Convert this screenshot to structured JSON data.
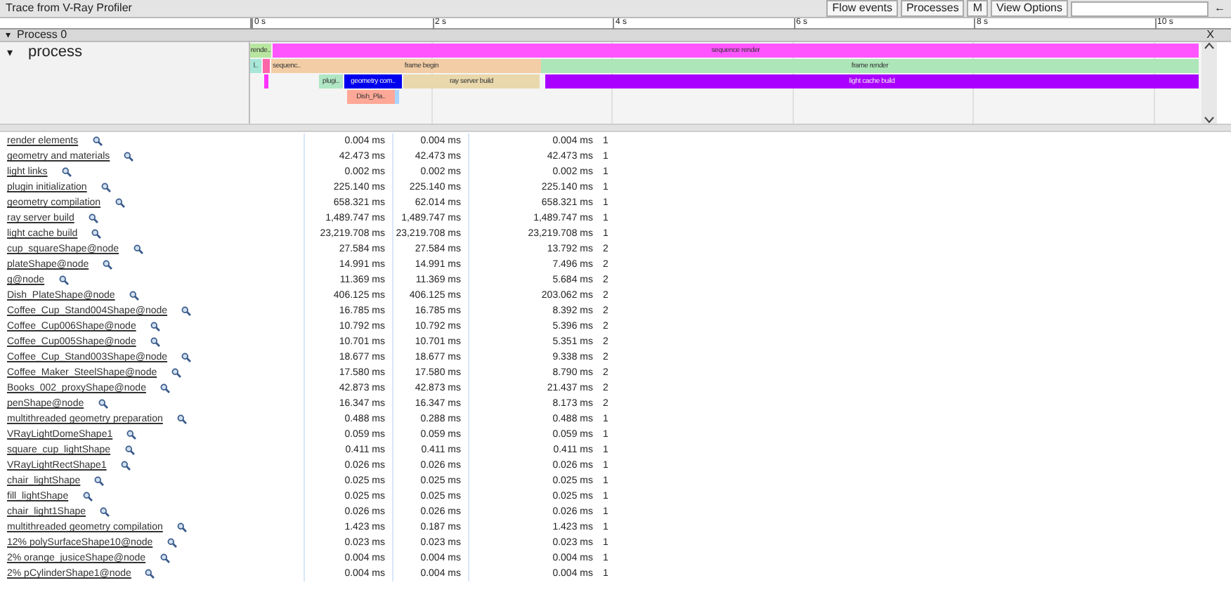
{
  "window": {
    "title": "Trace from V-Ray Profiler"
  },
  "toolbar": {
    "buttons": [
      "Flow events",
      "Processes",
      "M",
      "View Options"
    ],
    "back": "←"
  },
  "ruler": {
    "ticks": [
      "0 s",
      "2 s",
      "4 s",
      "6 s",
      "8 s",
      "10 s"
    ]
  },
  "process_header": {
    "toggle": "▾",
    "label": "Process 0",
    "close": "X"
  },
  "thread": {
    "toggle": "▾",
    "label": "process"
  },
  "tracks": [
    [
      {
        "label": "rende..",
        "color": "#b8e6a0"
      },
      {
        "label": "sequence render",
        "color": "#ff55ff"
      }
    ],
    [
      {
        "label": "l..",
        "color": "#a8e6d8"
      },
      {
        "color": "#ff66aa"
      },
      {
        "label": "sequenc..",
        "color": "#f2cda6"
      },
      {
        "label": "frame begin",
        "color": "#f2cda6"
      },
      {
        "label": "frame render",
        "color": "#ade6b8"
      }
    ],
    [
      {
        "color": "#ff33ff"
      },
      {
        "label": "plugi..",
        "color": "#b0e6c4"
      },
      {
        "label": "geometry com..",
        "color": "#0000ee"
      },
      {
        "label": "ray server build",
        "color": "#e8d8ac"
      },
      {
        "label": "light cache build",
        "color": "#aa00ff"
      }
    ],
    [
      {
        "label": "Dish_Pla..",
        "color": "#ffa898"
      },
      {
        "color": "#a8d4ff"
      }
    ]
  ],
  "rows": [
    {
      "name": "render elements",
      "total": "0.004 ms",
      "self": "0.004 ms",
      "avg": "0.004 ms",
      "count": "1"
    },
    {
      "name": "geometry and materials",
      "total": "42.473 ms",
      "self": "42.473 ms",
      "avg": "42.473 ms",
      "count": "1"
    },
    {
      "name": "light links",
      "total": "0.002 ms",
      "self": "0.002 ms",
      "avg": "0.002 ms",
      "count": "1"
    },
    {
      "name": "plugin initialization",
      "total": "225.140 ms",
      "self": "225.140 ms",
      "avg": "225.140 ms",
      "count": "1"
    },
    {
      "name": "geometry compilation",
      "total": "658.321 ms",
      "self": "62.014 ms",
      "avg": "658.321 ms",
      "count": "1"
    },
    {
      "name": "ray server build",
      "total": "1,489.747 ms",
      "self": "1,489.747 ms",
      "avg": "1,489.747 ms",
      "count": "1"
    },
    {
      "name": "light cache build",
      "total": "23,219.708 ms",
      "self": "23,219.708 ms",
      "avg": "23,219.708 ms",
      "count": "1"
    },
    {
      "name": "cup_squareShape@node",
      "total": "27.584 ms",
      "self": "27.584 ms",
      "avg": "13.792 ms",
      "count": "2"
    },
    {
      "name": "plateShape@node",
      "total": "14.991 ms",
      "self": "14.991 ms",
      "avg": "7.496 ms",
      "count": "2"
    },
    {
      "name": "g@node",
      "total": "11.369 ms",
      "self": "11.369 ms",
      "avg": "5.684 ms",
      "count": "2"
    },
    {
      "name": "Dish_PlateShape@node",
      "total": "406.125 ms",
      "self": "406.125 ms",
      "avg": "203.062 ms",
      "count": "2"
    },
    {
      "name": "Coffee_Cup_Stand004Shape@node",
      "total": "16.785 ms",
      "self": "16.785 ms",
      "avg": "8.392 ms",
      "count": "2"
    },
    {
      "name": "Coffee_Cup006Shape@node",
      "total": "10.792 ms",
      "self": "10.792 ms",
      "avg": "5.396 ms",
      "count": "2"
    },
    {
      "name": "Coffee_Cup005Shape@node",
      "total": "10.701 ms",
      "self": "10.701 ms",
      "avg": "5.351 ms",
      "count": "2"
    },
    {
      "name": "Coffee_Cup_Stand003Shape@node",
      "total": "18.677 ms",
      "self": "18.677 ms",
      "avg": "9.338 ms",
      "count": "2"
    },
    {
      "name": "Coffee_Maker_SteelShape@node",
      "total": "17.580 ms",
      "self": "17.580 ms",
      "avg": "8.790 ms",
      "count": "2"
    },
    {
      "name": "Books_002_proxyShape@node",
      "total": "42.873 ms",
      "self": "42.873 ms",
      "avg": "21.437 ms",
      "count": "2"
    },
    {
      "name": "penShape@node",
      "total": "16.347 ms",
      "self": "16.347 ms",
      "avg": "8.173 ms",
      "count": "2"
    },
    {
      "name": "multithreaded geometry preparation",
      "total": "0.488 ms",
      "self": "0.288 ms",
      "avg": "0.488 ms",
      "count": "1"
    },
    {
      "name": "VRayLightDomeShape1",
      "total": "0.059 ms",
      "self": "0.059 ms",
      "avg": "0.059 ms",
      "count": "1"
    },
    {
      "name": "square_cup_lightShape",
      "total": "0.411 ms",
      "self": "0.411 ms",
      "avg": "0.411 ms",
      "count": "1"
    },
    {
      "name": "VRayLightRectShape1",
      "total": "0.026 ms",
      "self": "0.026 ms",
      "avg": "0.026 ms",
      "count": "1"
    },
    {
      "name": "chair_lightShape",
      "total": "0.025 ms",
      "self": "0.025 ms",
      "avg": "0.025 ms",
      "count": "1"
    },
    {
      "name": "fill_lightShape",
      "total": "0.025 ms",
      "self": "0.025 ms",
      "avg": "0.025 ms",
      "count": "1"
    },
    {
      "name": "chair_light1Shape",
      "total": "0.026 ms",
      "self": "0.026 ms",
      "avg": "0.026 ms",
      "count": "1"
    },
    {
      "name": "multithreaded geometry compilation",
      "total": "1.423 ms",
      "self": "0.187 ms",
      "avg": "1.423 ms",
      "count": "1"
    },
    {
      "name": "12% polySurfaceShape10@node",
      "total": "0.023 ms",
      "self": "0.023 ms",
      "avg": "0.023 ms",
      "count": "1"
    },
    {
      "name": "2% orange_jusiceShape@node",
      "total": "0.004 ms",
      "self": "0.004 ms",
      "avg": "0.004 ms",
      "count": "1"
    },
    {
      "name": "2% pCylinderShape1@node",
      "total": "0.004 ms",
      "self": "0.004 ms",
      "avg": "0.004 ms",
      "count": "1"
    }
  ]
}
